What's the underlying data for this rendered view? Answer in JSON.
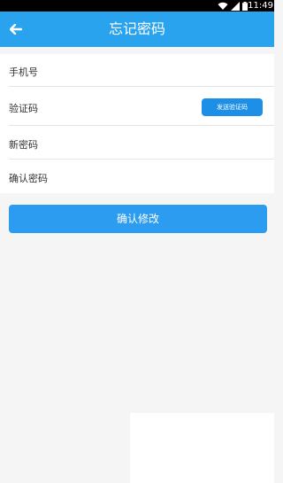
{
  "status_bar": {
    "time": "11:49"
  },
  "header": {
    "title": "忘记密码"
  },
  "form": {
    "phone_label": "手机号",
    "code_label": "验证码",
    "new_password_label": "新密码",
    "confirm_password_label": "确认密码"
  },
  "send_code_button": {
    "label": "发送验证码"
  },
  "confirm_button": {
    "label": "确认修改"
  },
  "colors": {
    "primary": "#2aa3ef",
    "button": "#2b9cf0",
    "background": "#f5f5f5"
  }
}
